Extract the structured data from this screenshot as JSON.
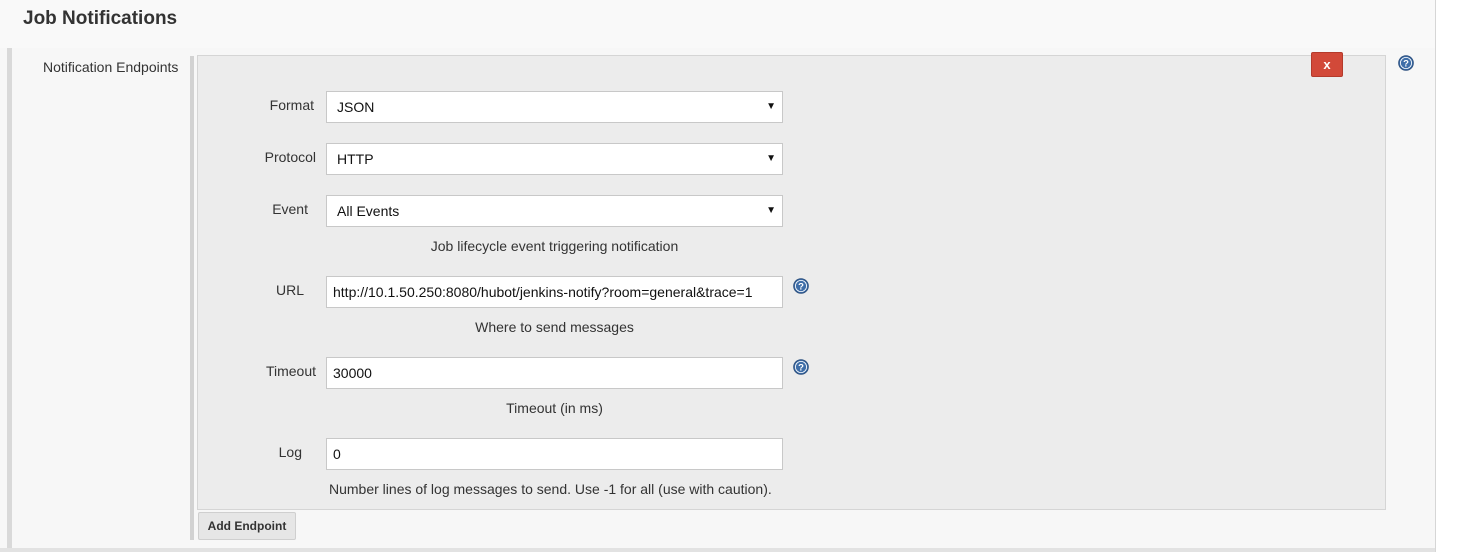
{
  "section": {
    "title": "Job Notifications"
  },
  "endpoints": {
    "label": "Notification Endpoints",
    "delete_label": "x",
    "add_label": "Add Endpoint"
  },
  "fields": {
    "format": {
      "label": "Format",
      "value": "JSON"
    },
    "protocol": {
      "label": "Protocol",
      "value": "HTTP"
    },
    "event": {
      "label": "Event",
      "value": "All Events",
      "description": "Job lifecycle event triggering notification"
    },
    "url": {
      "label": "URL",
      "value": "http://10.1.50.250:8080/hubot/jenkins-notify?room=general&trace=1",
      "description": "Where to send messages"
    },
    "timeout": {
      "label": "Timeout",
      "value": "30000",
      "description": "Timeout (in ms)"
    },
    "log": {
      "label": "Log",
      "value": "0",
      "description": "Number lines of log messages to send. Use -1 for all (use with caution)."
    }
  },
  "icons": {
    "help": "help-icon",
    "dropdown": "chevron-down-icon"
  },
  "colors": {
    "delete_button": "#d24939",
    "help_icon": "#3f6ea8",
    "panel_background": "#ececec"
  }
}
